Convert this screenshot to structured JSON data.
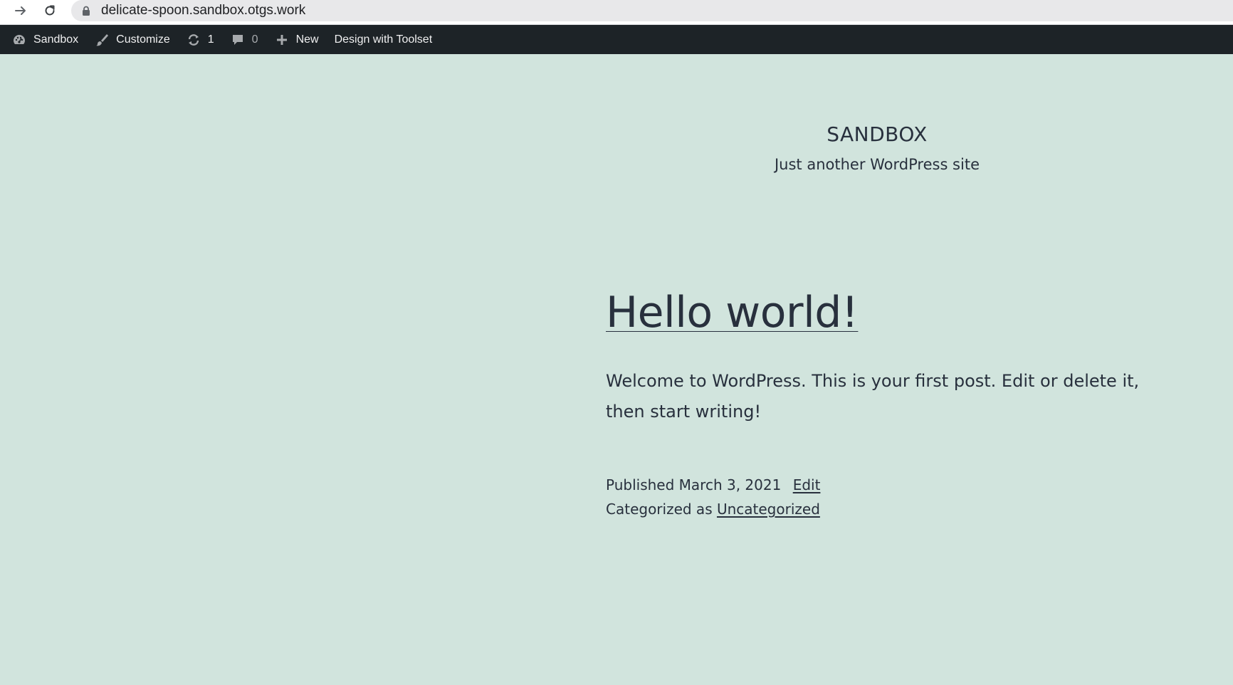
{
  "browser": {
    "url": "delicate-spoon.sandbox.otgs.work",
    "icons": {
      "forward": "arrow-right-icon",
      "reload": "reload-icon",
      "lock": "lock-icon"
    }
  },
  "admin_bar": {
    "site_name": "Sandbox",
    "customize_label": "Customize",
    "updates_count": "1",
    "comments_count": "0",
    "new_label": "New",
    "toolset_label": "Design with Toolset",
    "icons": {
      "site": "dashboard-icon",
      "customize": "brush-icon",
      "updates": "updates-icon",
      "comments": "comment-icon",
      "new": "plus-icon"
    }
  },
  "site": {
    "title": "SANDBOX",
    "description": "Just another WordPress site"
  },
  "post": {
    "title": "Hello world!",
    "content": "Welcome to WordPress. This is your first post. Edit or delete it, then start writing!",
    "published_label": "Published",
    "published_date": "March 3, 2021",
    "edit_label": "Edit",
    "categorized_label": "Categorized as",
    "category": "Uncategorized"
  },
  "colors": {
    "page_background": "#d1e4dd",
    "admin_bar_background": "#1d2327",
    "text": "#28303d"
  }
}
